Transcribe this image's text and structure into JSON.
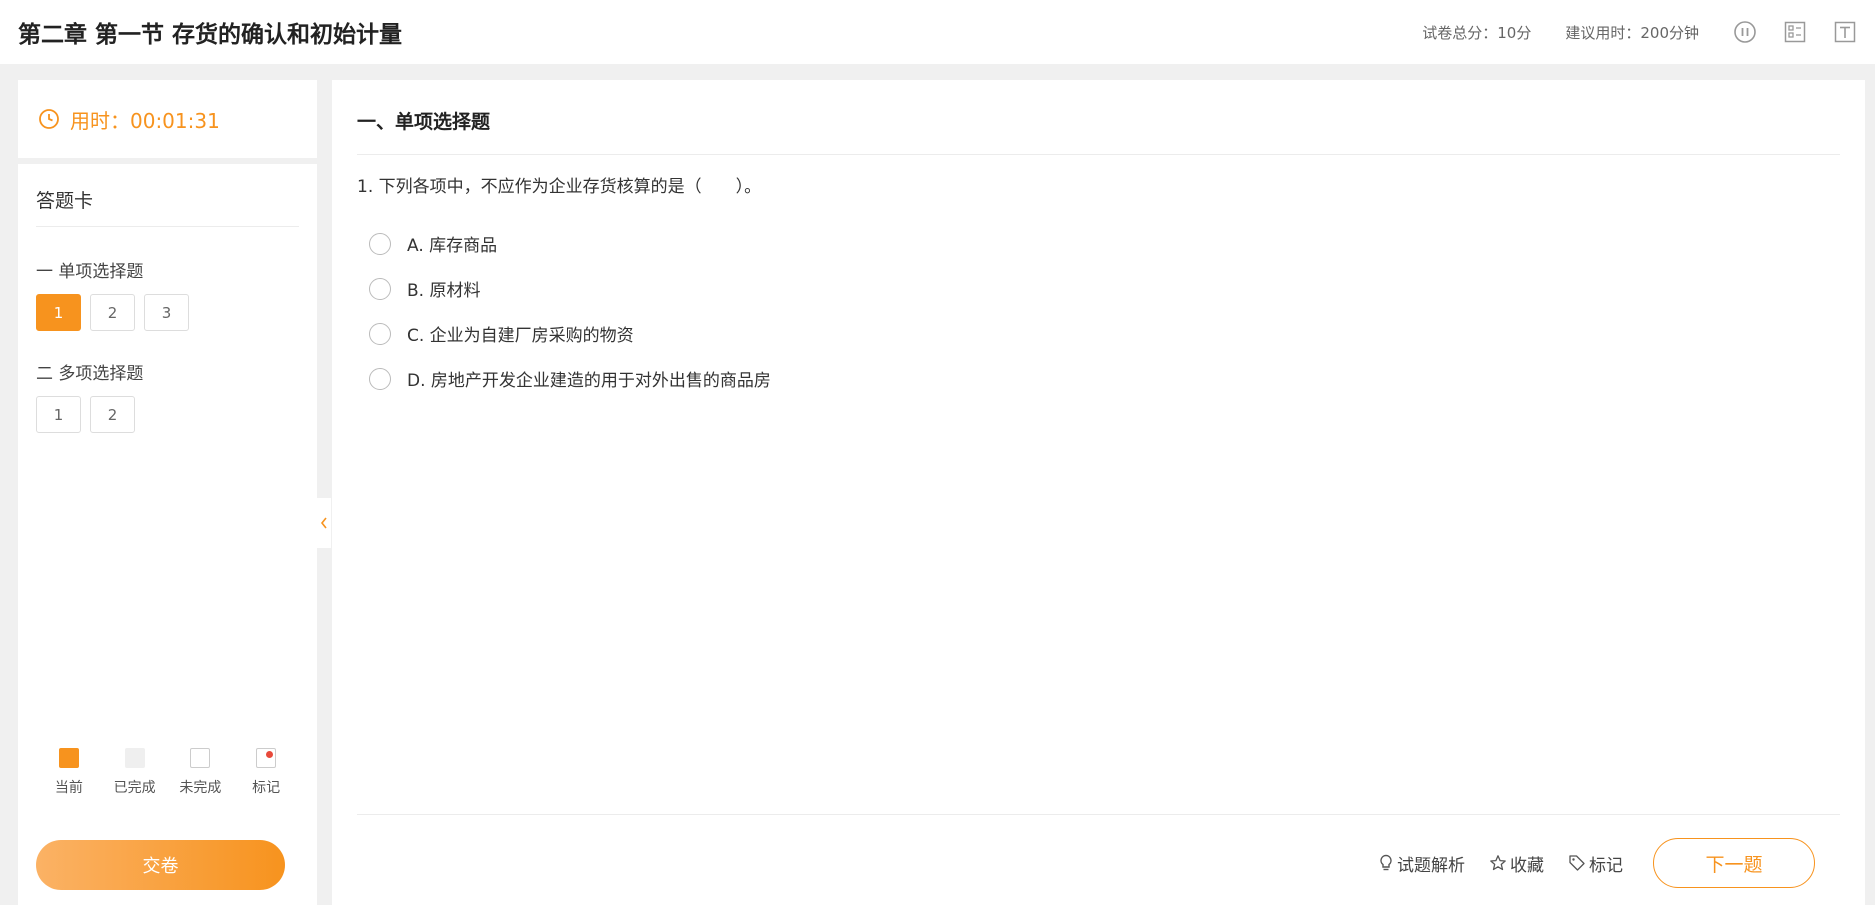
{
  "header": {
    "title": "第二章 第一节 存货的确认和初始计量",
    "total_score": "试卷总分：10分",
    "suggested_time": "建议用时：200分钟",
    "icons": [
      "pause-icon",
      "answer-card-icon",
      "font-size-icon"
    ]
  },
  "sidebar": {
    "timer": "用时：00:01:31",
    "card_title": "答题卡",
    "groups": [
      {
        "label": "一 单项选择题",
        "numbers": [
          "1",
          "2",
          "3"
        ],
        "current_index": 0
      },
      {
        "label": "二 多项选择题",
        "numbers": [
          "1",
          "2"
        ]
      }
    ],
    "legend": {
      "current": "当前",
      "done": "已完成",
      "todo": "未完成",
      "mark": "标记"
    },
    "submit_label": "交卷"
  },
  "main": {
    "section_title": "一、单项选择题",
    "question": "1. 下列各项中，不应作为企业存货核算的是（　　）。",
    "options": [
      "A. 库存商品",
      "B. 原材料",
      "C. 企业为自建厂房采购的物资",
      "D. 房地产开发企业建造的用于对外出售的商品房"
    ],
    "actions": {
      "analysis": "试题解析",
      "favorite": "收藏",
      "mark": "标记",
      "next": "下一题"
    }
  },
  "colors": {
    "accent": "#f7931e",
    "mark_dot": "#e84a3b",
    "background": "#f0f0f0"
  }
}
